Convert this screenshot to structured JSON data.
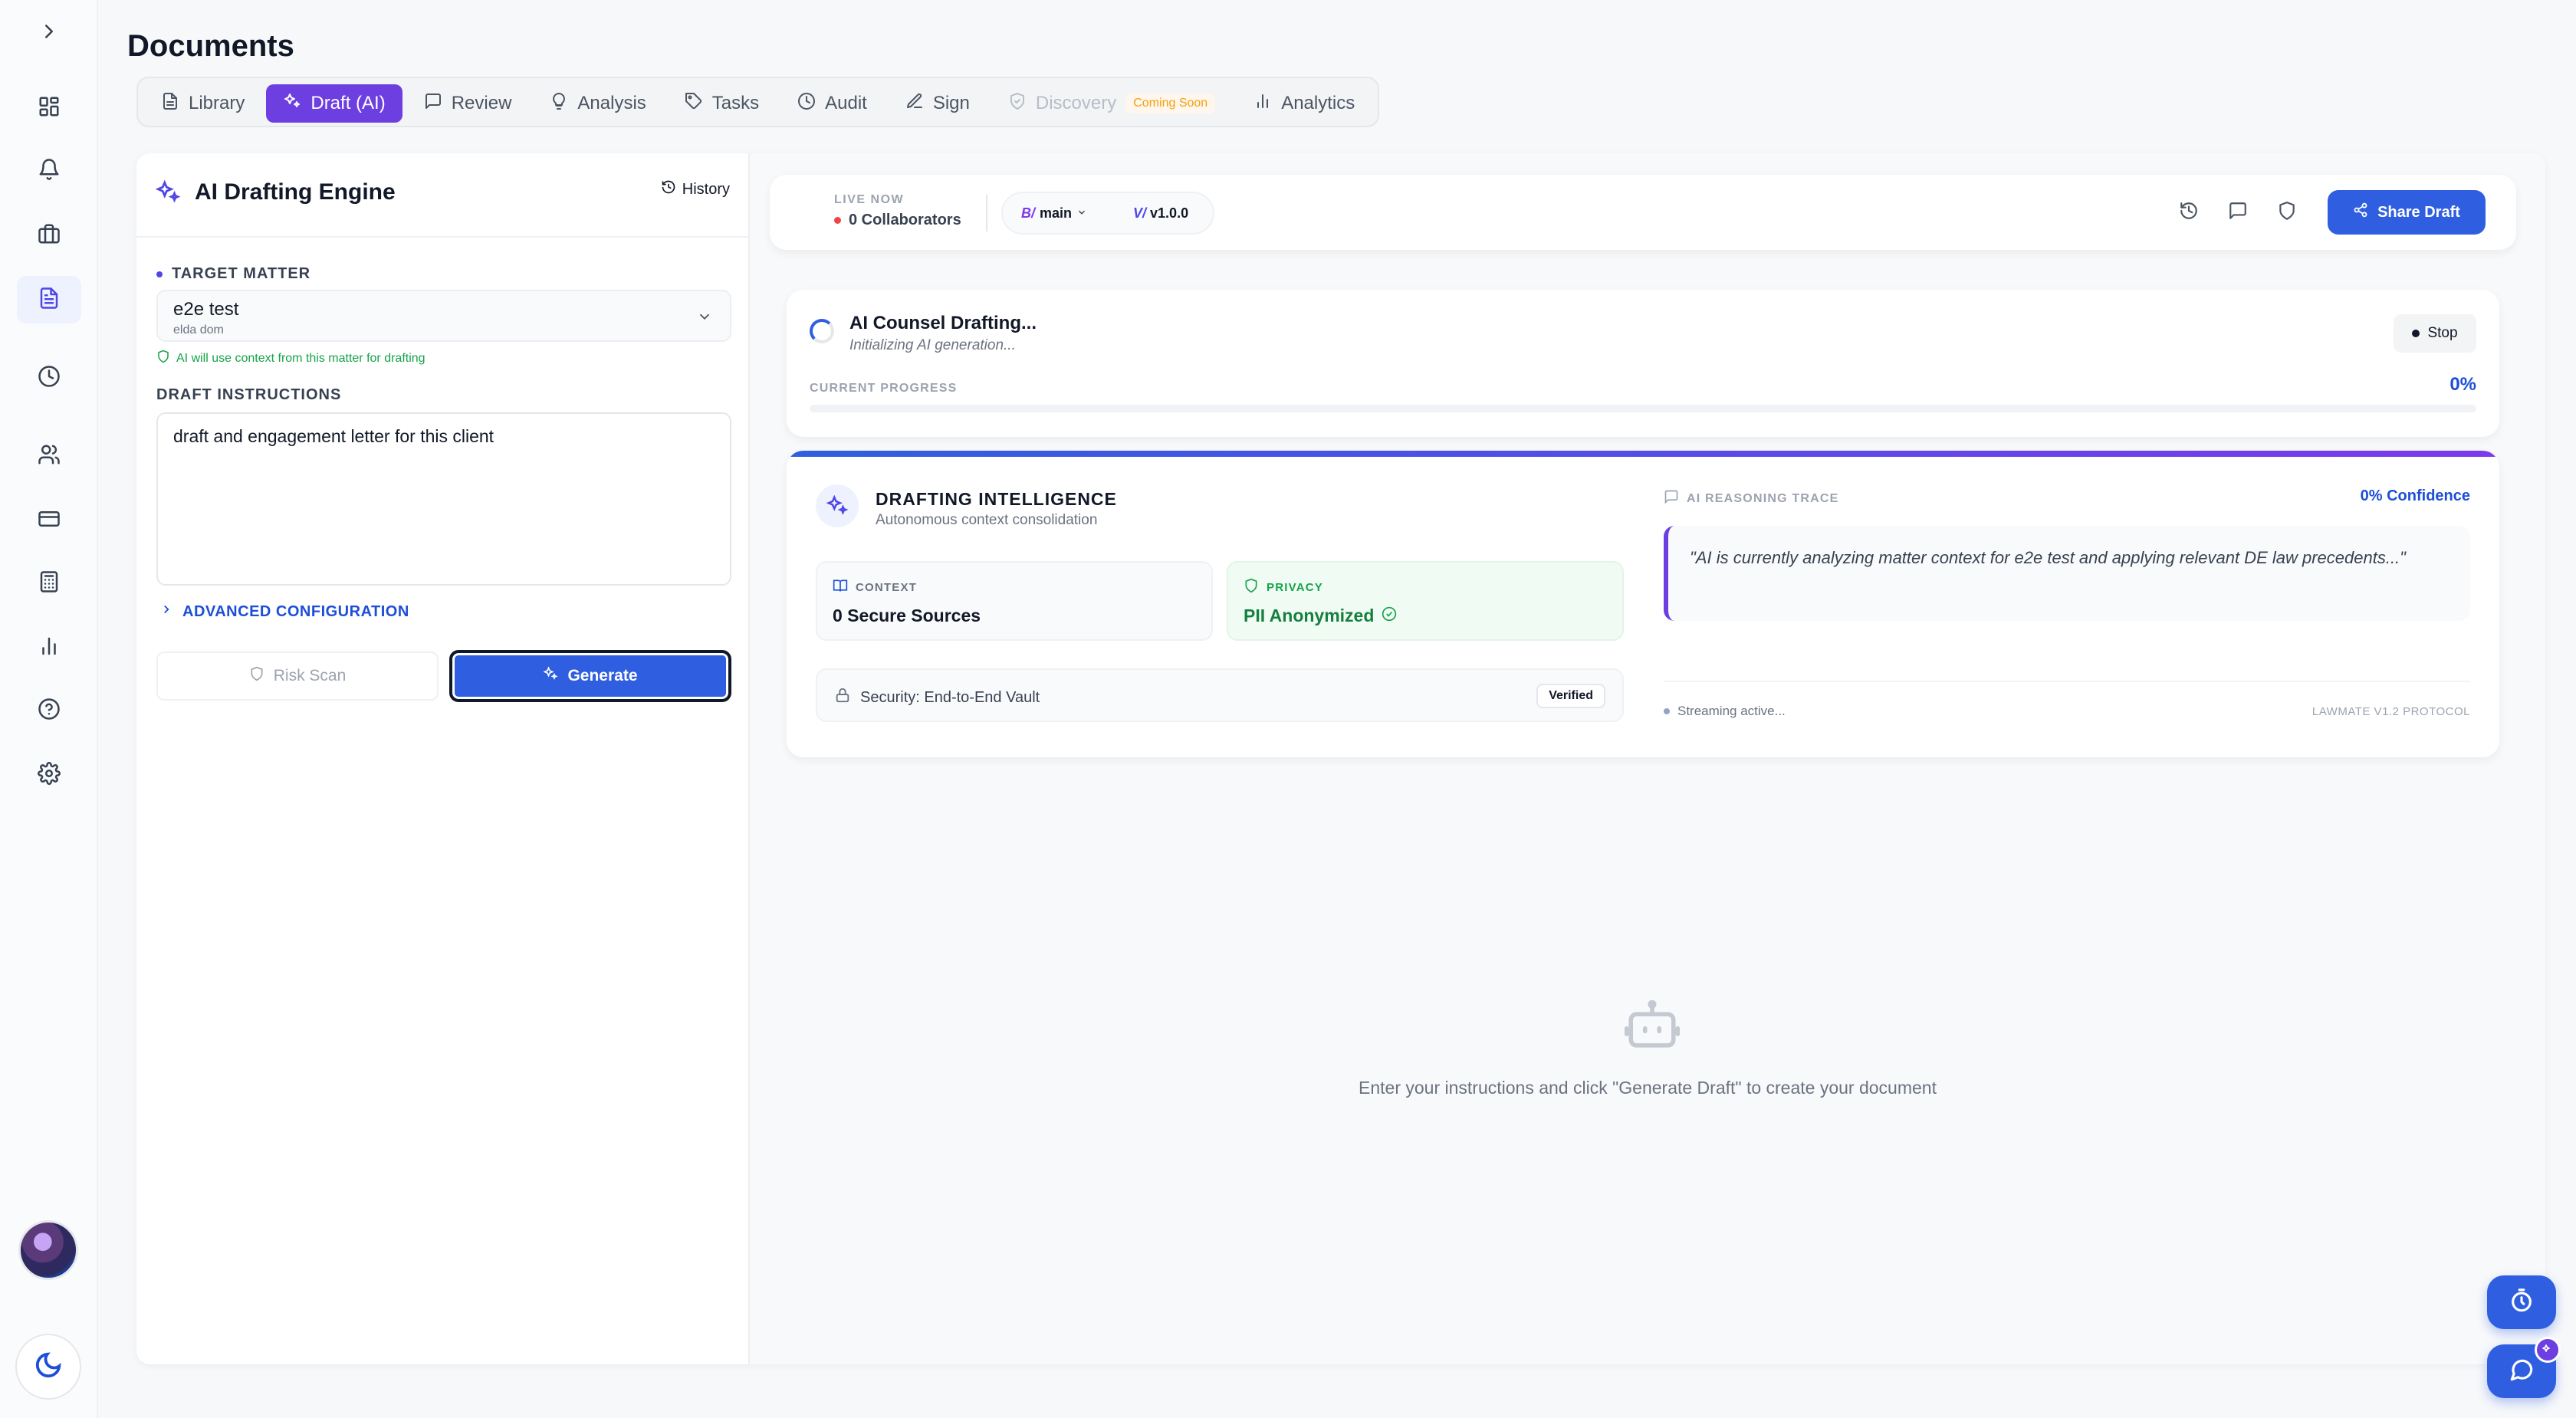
{
  "page": {
    "title": "Documents"
  },
  "rail": {
    "items": [
      {
        "name": "expand-sidebar",
        "icon": "chevron-right-icon"
      },
      {
        "name": "dashboard",
        "icon": "grid-icon"
      },
      {
        "name": "notifications",
        "icon": "bell-icon"
      },
      {
        "name": "matters",
        "icon": "briefcase-icon"
      },
      {
        "name": "documents",
        "icon": "document-icon",
        "active": true
      },
      {
        "name": "time",
        "icon": "clock-icon"
      },
      {
        "name": "clients",
        "icon": "users-icon"
      },
      {
        "name": "billing",
        "icon": "credit-card-icon"
      },
      {
        "name": "calculator",
        "icon": "calculator-icon"
      },
      {
        "name": "reports",
        "icon": "bar-chart-icon"
      },
      {
        "name": "help",
        "icon": "help-icon"
      },
      {
        "name": "settings",
        "icon": "gear-icon"
      }
    ],
    "theme_icon": "moon-icon"
  },
  "tabs": [
    {
      "label": "Library",
      "icon": "document-icon"
    },
    {
      "label": "Draft (AI)",
      "icon": "sparkles-icon",
      "active": true
    },
    {
      "label": "Review",
      "icon": "comment-icon"
    },
    {
      "label": "Analysis",
      "icon": "lightbulb-icon"
    },
    {
      "label": "Tasks",
      "icon": "tag-icon"
    },
    {
      "label": "Audit",
      "icon": "clock-icon"
    },
    {
      "label": "Sign",
      "icon": "pen-icon"
    },
    {
      "label": "Discovery",
      "icon": "shield-check-icon",
      "disabled": true,
      "badge": "Coming Soon"
    },
    {
      "label": "Analytics",
      "icon": "bar-chart-icon"
    }
  ],
  "left_panel": {
    "title": "AI Drafting Engine",
    "history_label": "History",
    "target_matter_label": "TARGET MATTER",
    "matter_name": "e2e test",
    "matter_client": "elda dom",
    "context_hint": "AI will use context from this matter for drafting",
    "draft_instructions_label": "DRAFT INSTRUCTIONS",
    "draft_instructions_value": "draft and engagement letter for this client",
    "advanced_label": "ADVANCED CONFIGURATION",
    "risk_scan_label": "Risk Scan",
    "generate_label": "Generate"
  },
  "topbar": {
    "live_label": "LIVE NOW",
    "collaborators": "0 Collaborators",
    "branch_prefix": "B/",
    "branch": "main",
    "version_prefix": "V/",
    "version": "v1.0.0",
    "share_label": "Share Draft",
    "accent_color": "#2f5fe0"
  },
  "progress": {
    "title": "AI Counsel Drafting...",
    "subtitle": "Initializing AI generation...",
    "stop_label": "Stop",
    "progress_label": "CURRENT PROGRESS",
    "progress_text": "0%",
    "progress_value": 0
  },
  "intelligence": {
    "title": "DRAFTING INTELLIGENCE",
    "subtitle": "Autonomous context consolidation",
    "context_label": "CONTEXT",
    "context_value": "0 Secure Sources",
    "privacy_label": "PRIVACY",
    "privacy_value": "PII Anonymized",
    "security_text": "Security: End-to-End Vault",
    "verified_label": "Verified",
    "trace_label": "AI REASONING TRACE",
    "confidence": "0% Confidence",
    "quote": "\"AI is currently analyzing matter context for e2e test and applying relevant DE law precedents...\"",
    "streaming": "Streaming active...",
    "protocol": "LAWMATE V1.2 PROTOCOL"
  },
  "empty_state": {
    "icon": "robot-icon",
    "text": "Enter your instructions and click \"Generate Draft\" to create your document"
  }
}
